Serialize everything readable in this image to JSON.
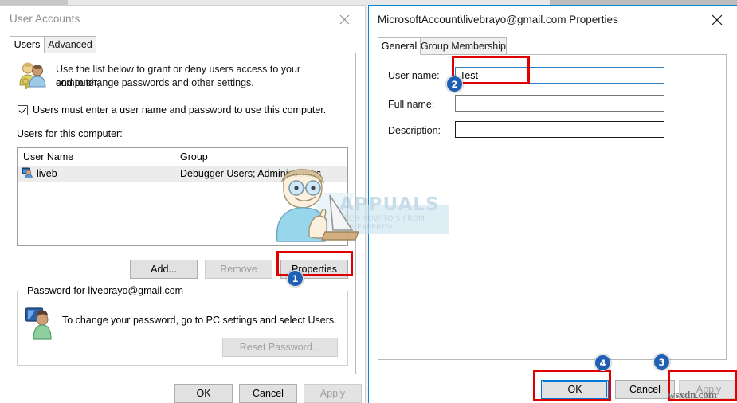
{
  "left_window": {
    "title": "User Accounts",
    "close_icon": "close-icon",
    "tabs": [
      {
        "label": "Users",
        "active": true
      },
      {
        "label": "Advanced",
        "active": false
      }
    ],
    "intro": {
      "icon": "users-key-icon",
      "line1": "Use the list below to grant or deny users access to your computer,",
      "line2": "and to change passwords and other settings."
    },
    "checkbox": {
      "label": "Users must enter a user name and password to use this computer.",
      "checked": true
    },
    "list_caption": "Users for this computer:",
    "list": {
      "columns": [
        "User Name",
        "Group"
      ],
      "rows": [
        {
          "icon": "user-account-icon",
          "user_name": "liveb",
          "group": "Debugger Users; Administrators"
        }
      ]
    },
    "list_buttons": [
      {
        "label": "Add...",
        "state": "enabled"
      },
      {
        "label": "Remove",
        "state": "disabled"
      },
      {
        "label": "Properties",
        "state": "enabled"
      }
    ],
    "password_group": {
      "legend": "Password for livebrayo@gmail.com",
      "icon": "user-monitor-icon",
      "text": "To change your password, go to PC settings and select Users.",
      "button": {
        "label": "Reset Password...",
        "state": "disabled"
      }
    },
    "footer_buttons": [
      {
        "label": "OK",
        "state": "enabled"
      },
      {
        "label": "Cancel",
        "state": "enabled"
      },
      {
        "label": "Apply",
        "state": "disabled"
      }
    ]
  },
  "right_window": {
    "title": "MicrosoftAccount\\livebrayo@gmail.com Properties",
    "close_icon": "close-icon",
    "tabs": [
      {
        "label": "General",
        "active": true
      },
      {
        "label": "Group Membership",
        "active": false
      }
    ],
    "fields": [
      {
        "label": "User name:",
        "value": "Test",
        "focused": true
      },
      {
        "label": "Full name:",
        "value": "",
        "focused": false
      },
      {
        "label": "Description:",
        "value": "",
        "focused": false
      }
    ],
    "footer_buttons": [
      {
        "label": "OK",
        "state": "focused"
      },
      {
        "label": "Cancel",
        "state": "enabled"
      },
      {
        "label": "Apply",
        "state": "disabled"
      }
    ]
  },
  "annotations": {
    "accent_color": "#e00000",
    "badge_color": "#1f5fb4",
    "steps": [
      "1",
      "2",
      "3",
      "4"
    ]
  },
  "watermarks": {
    "brand": "APPUALS",
    "tagline_line1": "TECH HOW-TO'S FROM",
    "tagline_line2": "THE EXPERTS!",
    "site": "wsxdn.com"
  }
}
